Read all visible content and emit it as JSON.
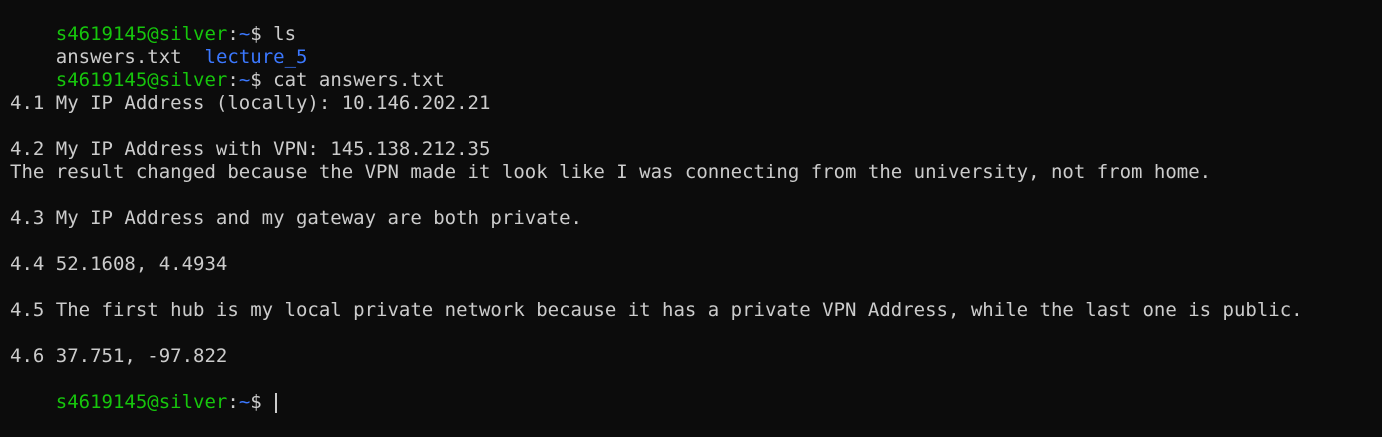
{
  "prompt": {
    "user_host": "s4619145@silver",
    "separator": ":",
    "cwd": "~",
    "symbol": "$ "
  },
  "commands": {
    "ls": "ls",
    "cat": "cat answers.txt",
    "current": ""
  },
  "ls_output": {
    "file": "answers.txt",
    "gap": "  ",
    "directory": "lecture_5"
  },
  "file_lines": [
    "",
    "4.1 My IP Address (locally): 10.146.202.21",
    "",
    "4.2 My IP Address with VPN: 145.138.212.35",
    "The result changed because the VPN made it look like I was connecting from the university, not from home.",
    "",
    "4.3 My IP Address and my gateway are both private.",
    "",
    "4.4 52.1608, 4.4934",
    "",
    "4.5 The first hub is my local private network because it has a private VPN Address, while the last one is public.",
    "",
    "4.6 37.751, -97.822"
  ],
  "colors": {
    "background": "#0c0c0c",
    "prompt_user": "#16c60c",
    "directory": "#3b78ff",
    "text": "#cccccc"
  }
}
